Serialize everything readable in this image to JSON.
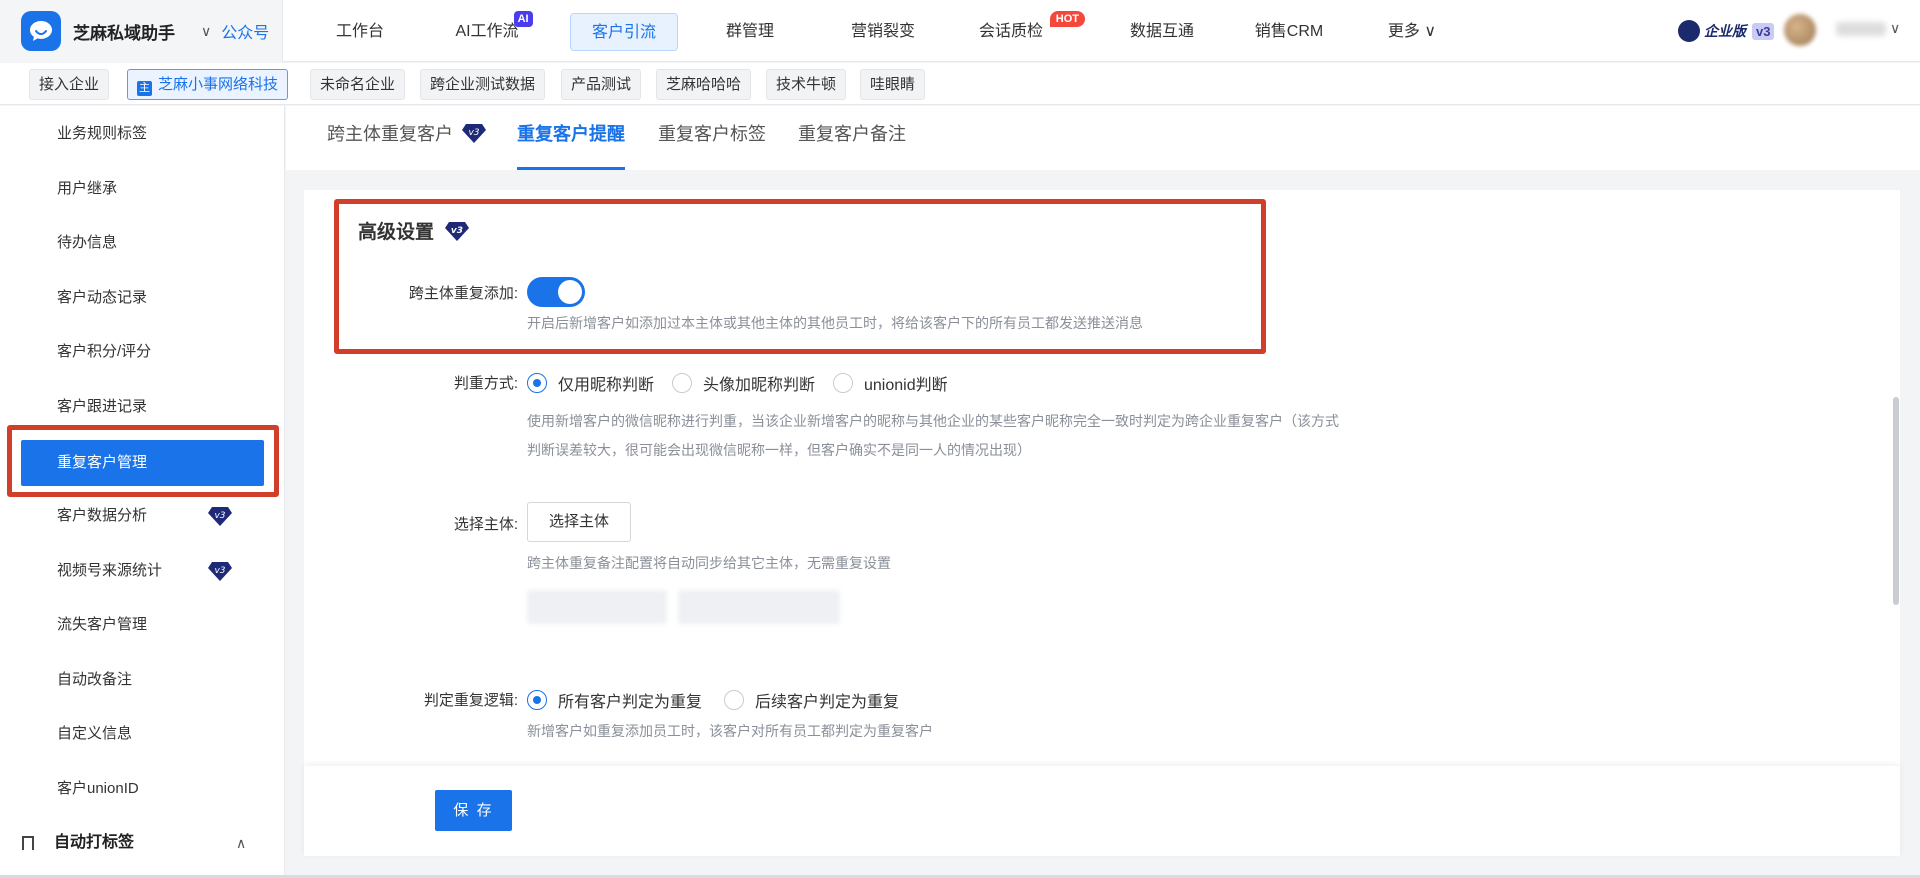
{
  "app": {
    "name": "芝麻私域助手",
    "sub": "公众号",
    "edition": "企业版",
    "version_tag": "v3",
    "user_name": "*** "
  },
  "nav": {
    "items": [
      {
        "label": "工作台"
      },
      {
        "label": "AI工作流",
        "badge": "AI"
      },
      {
        "label": "客户引流"
      },
      {
        "label": "群管理"
      },
      {
        "label": "营销裂变"
      },
      {
        "label": "会话质检",
        "badge": "HOT"
      },
      {
        "label": "数据互通"
      },
      {
        "label": "销售CRM"
      },
      {
        "label": "更多"
      }
    ]
  },
  "corps": {
    "items": [
      {
        "label": "接入企业"
      },
      {
        "label": "芝麻小事网络科技",
        "icon": "主"
      },
      {
        "label": "未命名企业"
      },
      {
        "label": "跨企业测试数据"
      },
      {
        "label": "产品测试"
      },
      {
        "label": "芝麻哈哈哈"
      },
      {
        "label": "技术牛顿"
      },
      {
        "label": "哇眼睛"
      }
    ]
  },
  "sidebar": {
    "items": [
      {
        "label": "业务规则标签"
      },
      {
        "label": "用户继承"
      },
      {
        "label": "待办信息"
      },
      {
        "label": "客户动态记录"
      },
      {
        "label": "客户积分/评分"
      },
      {
        "label": "客户跟进记录"
      },
      {
        "label": "重复客户管理"
      },
      {
        "label": "客户数据分析",
        "tag": "v3"
      },
      {
        "label": "视频号来源统计",
        "tag": "v3"
      },
      {
        "label": "流失客户管理"
      },
      {
        "label": "自动改备注"
      },
      {
        "label": "自定义信息"
      },
      {
        "label": "客户unionID"
      }
    ],
    "group": {
      "label": "自动打标签"
    }
  },
  "subtabs": {
    "items": [
      {
        "label": "跨主体重复客户",
        "tag": "v3"
      },
      {
        "label": "重复客户提醒"
      },
      {
        "label": "重复客户标签"
      },
      {
        "label": "重复客户备注"
      }
    ]
  },
  "form": {
    "section_title": "高级设置",
    "section_tag": "v3",
    "cross_add": {
      "label": "跨主体重复添加:",
      "enabled": true,
      "hint": "开启后新增客户如添加过本主体或其他主体的其他员工时，将给该客户下的所有员工都发送推送消息"
    },
    "judge_method": {
      "label": "判重方式:",
      "options": [
        "仅用昵称判断",
        "头像加昵称判断",
        "unionid判断"
      ],
      "selected": "仅用昵称判断",
      "hint_line1": "使用新增客户的微信昵称进行判重，当该企业新增客户的昵称与其他企业的某些客户昵称完全一致时判定为跨企业重复客户（该方式",
      "hint_line2": "判断误差较大，很可能会出现微信昵称一样，但客户确实不是同一人的情况出现）"
    },
    "select_subject": {
      "label": "选择主体:",
      "button": "选择主体",
      "hint": "跨主体重复备注配置将自动同步给其它主体，无需重复设置"
    },
    "judge_logic": {
      "label": "判定重复逻辑:",
      "options": [
        "所有客户判定为重复",
        "后续客户判定为重复"
      ],
      "selected": "所有客户判定为重复",
      "hint": "新增客户如重复添加员工时，该客户对所有员工都判定为重复客户"
    },
    "save_label": "保 存"
  },
  "colors": {
    "primary": "#1a73e8",
    "highlight": "#d13f2a",
    "badge_ai": "#4b3cf0",
    "badge_hot": "#f5483b"
  }
}
